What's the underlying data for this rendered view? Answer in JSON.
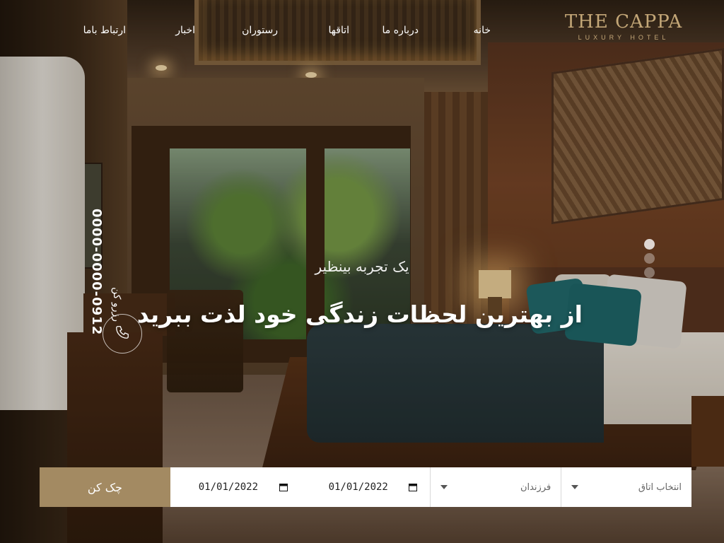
{
  "brand": {
    "name": "THE CAPPA",
    "tagline": "LUXURY HOTEL",
    "color": "#c3a677"
  },
  "nav": {
    "items": [
      {
        "label": "خانه"
      },
      {
        "label": "درباره ما"
      },
      {
        "label": "اتاقها"
      },
      {
        "label": "رستوران"
      },
      {
        "label": "اخبار"
      },
      {
        "label": "ارتباط باما"
      }
    ]
  },
  "hero": {
    "subtitle": "یک تجربه بینظیر",
    "title": "از بهترین لحظات زندگی خود لذت ببرید",
    "slides_total": 3,
    "active_slide": 1
  },
  "contact": {
    "label": "رزرو کن",
    "phone": "0000-0000-0912",
    "icon": "phone-icon"
  },
  "booking": {
    "check_label": "چک کن",
    "check_in": "01/01/2022",
    "check_out": "01/01/2022",
    "children_placeholder": "فرزندان",
    "room_placeholder": "انتخاب اتاق",
    "accent_color": "#a38a62"
  }
}
